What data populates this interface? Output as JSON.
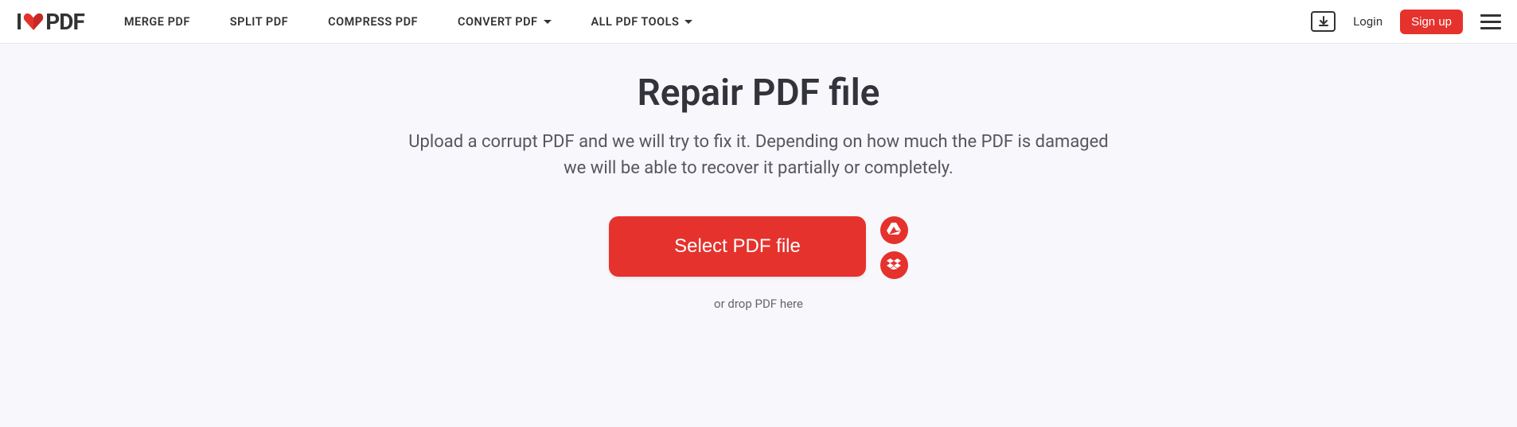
{
  "logo": {
    "prefix": "I",
    "suffix": "PDF"
  },
  "nav": {
    "items": [
      {
        "label": "MERGE PDF",
        "hasDropdown": false
      },
      {
        "label": "SPLIT PDF",
        "hasDropdown": false
      },
      {
        "label": "COMPRESS PDF",
        "hasDropdown": false
      },
      {
        "label": "CONVERT PDF",
        "hasDropdown": true
      },
      {
        "label": "ALL PDF TOOLS",
        "hasDropdown": true
      }
    ]
  },
  "header": {
    "login": "Login",
    "signup": "Sign up"
  },
  "main": {
    "title": "Repair PDF file",
    "subtitle": "Upload a corrupt PDF and we will try to fix it. Depending on how much the PDF is damaged we will be able to recover it partially or completely.",
    "selectButton": "Select PDF file",
    "dropHint": "or drop PDF here"
  },
  "colors": {
    "accent": "#e5322d"
  }
}
